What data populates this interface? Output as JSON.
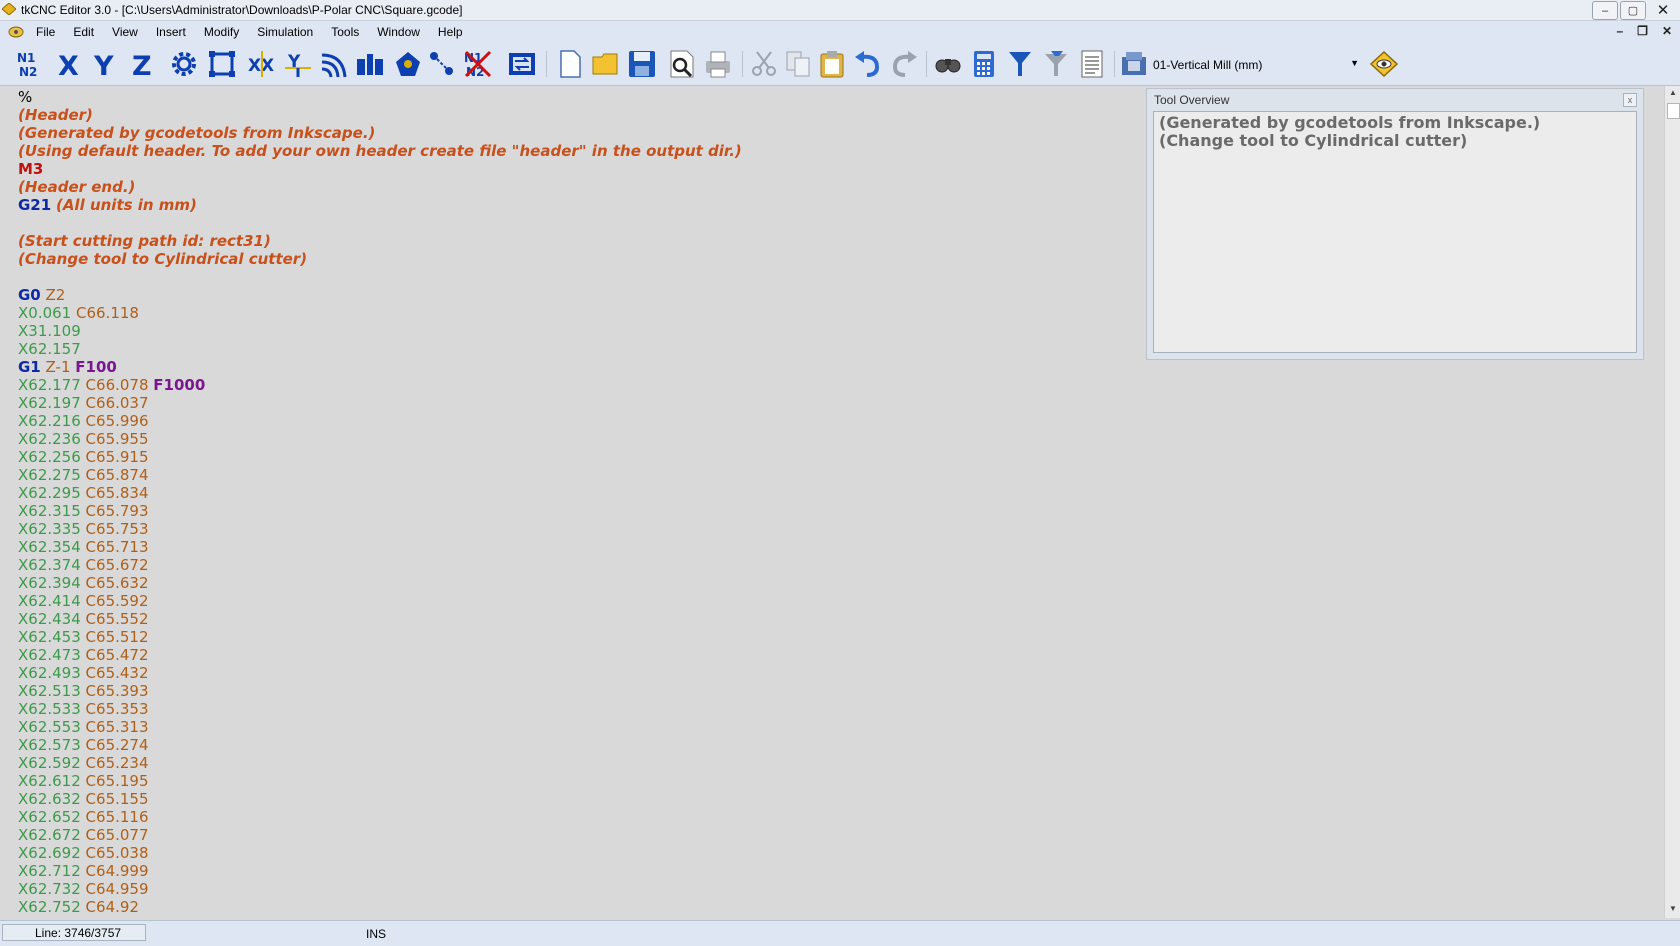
{
  "window": {
    "title": "tkCNC Editor 3.0 - [C:\\Users\\Administrator\\Downloads\\P-Polar CNC\\Square.gcode]",
    "controls": {
      "minimize": "–",
      "maximize": "▢",
      "close": "✕"
    }
  },
  "menu": {
    "items": [
      "File",
      "Edit",
      "View",
      "Insert",
      "Modify",
      "Simulation",
      "Tools",
      "Window",
      "Help"
    ],
    "mdi_controls": [
      "–",
      "❐",
      "✕"
    ]
  },
  "toolbar": {
    "machine_selector": "01-Vertical Mill (mm)",
    "buttons": [
      "renumber-icon",
      "axis-x-icon",
      "axis-y-icon",
      "axis-z-icon",
      "gear-icon",
      "bounding-box-icon",
      "swap-xy-icon",
      "mirror-icon",
      "arc-icon",
      "block-icon",
      "rotate-icon",
      "scale-icon",
      "remove-numbers-icon",
      "convert-icon",
      "new-file-icon",
      "open-folder-icon",
      "save-icon",
      "print-preview-icon",
      "print-icon",
      "cut-icon",
      "copy-icon",
      "paste-icon",
      "undo-icon",
      "redo-icon",
      "find-icon",
      "calculator-icon",
      "filter-icon",
      "filter-clear-icon",
      "document-properties-icon",
      "machine-icon",
      "simulate-icon"
    ]
  },
  "editor": {
    "lines": [
      [
        {
          "t": "%",
          "c": "pct"
        }
      ],
      [
        {
          "t": "(Header)",
          "c": "comment"
        }
      ],
      [
        {
          "t": "(Generated by gcodetools from Inkscape.)",
          "c": "comment"
        }
      ],
      [
        {
          "t": "(Using default header. To add your own header create file \"header\" in the output dir.)",
          "c": "comment"
        }
      ],
      [
        {
          "t": "M3",
          "c": "m"
        }
      ],
      [
        {
          "t": "(Header end.)",
          "c": "comment"
        }
      ],
      [
        {
          "t": "G21",
          "c": "g"
        },
        {
          "t": " "
        },
        {
          "t": "(All units in mm)",
          "c": "comment"
        }
      ],
      [],
      [
        {
          "t": "(Start cutting path id: rect31)",
          "c": "comment"
        }
      ],
      [
        {
          "t": "(Change tool to Cylindrical cutter)",
          "c": "comment"
        }
      ],
      [],
      [
        {
          "t": "G0",
          "c": "g"
        },
        {
          "t": " "
        },
        {
          "t": "Z2",
          "c": "z"
        }
      ],
      [
        {
          "t": "X0.061",
          "c": "x"
        },
        {
          "t": " "
        },
        {
          "t": "C66.118",
          "c": "c"
        }
      ],
      [
        {
          "t": "X31.109",
          "c": "x"
        }
      ],
      [
        {
          "t": "X62.157",
          "c": "x"
        }
      ],
      [
        {
          "t": "G1",
          "c": "g"
        },
        {
          "t": " "
        },
        {
          "t": "Z-1",
          "c": "z"
        },
        {
          "t": " "
        },
        {
          "t": "F100",
          "c": "f"
        }
      ],
      [
        {
          "t": "X62.177",
          "c": "x"
        },
        {
          "t": " "
        },
        {
          "t": "C66.078",
          "c": "c"
        },
        {
          "t": " "
        },
        {
          "t": "F1000",
          "c": "f"
        }
      ],
      [
        {
          "t": "X62.197",
          "c": "x"
        },
        {
          "t": " "
        },
        {
          "t": "C66.037",
          "c": "c"
        }
      ],
      [
        {
          "t": "X62.216",
          "c": "x"
        },
        {
          "t": " "
        },
        {
          "t": "C65.996",
          "c": "c"
        }
      ],
      [
        {
          "t": "X62.236",
          "c": "x"
        },
        {
          "t": " "
        },
        {
          "t": "C65.955",
          "c": "c"
        }
      ],
      [
        {
          "t": "X62.256",
          "c": "x"
        },
        {
          "t": " "
        },
        {
          "t": "C65.915",
          "c": "c"
        }
      ],
      [
        {
          "t": "X62.275",
          "c": "x"
        },
        {
          "t": " "
        },
        {
          "t": "C65.874",
          "c": "c"
        }
      ],
      [
        {
          "t": "X62.295",
          "c": "x"
        },
        {
          "t": " "
        },
        {
          "t": "C65.834",
          "c": "c"
        }
      ],
      [
        {
          "t": "X62.315",
          "c": "x"
        },
        {
          "t": " "
        },
        {
          "t": "C65.793",
          "c": "c"
        }
      ],
      [
        {
          "t": "X62.335",
          "c": "x"
        },
        {
          "t": " "
        },
        {
          "t": "C65.753",
          "c": "c"
        }
      ],
      [
        {
          "t": "X62.354",
          "c": "x"
        },
        {
          "t": " "
        },
        {
          "t": "C65.713",
          "c": "c"
        }
      ],
      [
        {
          "t": "X62.374",
          "c": "x"
        },
        {
          "t": " "
        },
        {
          "t": "C65.672",
          "c": "c"
        }
      ],
      [
        {
          "t": "X62.394",
          "c": "x"
        },
        {
          "t": " "
        },
        {
          "t": "C65.632",
          "c": "c"
        }
      ],
      [
        {
          "t": "X62.414",
          "c": "x"
        },
        {
          "t": " "
        },
        {
          "t": "C65.592",
          "c": "c"
        }
      ],
      [
        {
          "t": "X62.434",
          "c": "x"
        },
        {
          "t": " "
        },
        {
          "t": "C65.552",
          "c": "c"
        }
      ],
      [
        {
          "t": "X62.453",
          "c": "x"
        },
        {
          "t": " "
        },
        {
          "t": "C65.512",
          "c": "c"
        }
      ],
      [
        {
          "t": "X62.473",
          "c": "x"
        },
        {
          "t": " "
        },
        {
          "t": "C65.472",
          "c": "c"
        }
      ],
      [
        {
          "t": "X62.493",
          "c": "x"
        },
        {
          "t": " "
        },
        {
          "t": "C65.432",
          "c": "c"
        }
      ],
      [
        {
          "t": "X62.513",
          "c": "x"
        },
        {
          "t": " "
        },
        {
          "t": "C65.393",
          "c": "c"
        }
      ],
      [
        {
          "t": "X62.533",
          "c": "x"
        },
        {
          "t": " "
        },
        {
          "t": "C65.353",
          "c": "c"
        }
      ],
      [
        {
          "t": "X62.553",
          "c": "x"
        },
        {
          "t": " "
        },
        {
          "t": "C65.313",
          "c": "c"
        }
      ],
      [
        {
          "t": "X62.573",
          "c": "x"
        },
        {
          "t": " "
        },
        {
          "t": "C65.274",
          "c": "c"
        }
      ],
      [
        {
          "t": "X62.592",
          "c": "x"
        },
        {
          "t": " "
        },
        {
          "t": "C65.234",
          "c": "c"
        }
      ],
      [
        {
          "t": "X62.612",
          "c": "x"
        },
        {
          "t": " "
        },
        {
          "t": "C65.195",
          "c": "c"
        }
      ],
      [
        {
          "t": "X62.632",
          "c": "x"
        },
        {
          "t": " "
        },
        {
          "t": "C65.155",
          "c": "c"
        }
      ],
      [
        {
          "t": "X62.652",
          "c": "x"
        },
        {
          "t": " "
        },
        {
          "t": "C65.116",
          "c": "c"
        }
      ],
      [
        {
          "t": "X62.672",
          "c": "x"
        },
        {
          "t": " "
        },
        {
          "t": "C65.077",
          "c": "c"
        }
      ],
      [
        {
          "t": "X62.692",
          "c": "x"
        },
        {
          "t": " "
        },
        {
          "t": "C65.038",
          "c": "c"
        }
      ],
      [
        {
          "t": "X62.712",
          "c": "x"
        },
        {
          "t": " "
        },
        {
          "t": "C64.999",
          "c": "c"
        }
      ],
      [
        {
          "t": "X62.732",
          "c": "x"
        },
        {
          "t": " "
        },
        {
          "t": "C64.959",
          "c": "c"
        }
      ],
      [
        {
          "t": "X62.752",
          "c": "x"
        },
        {
          "t": " "
        },
        {
          "t": "C64.92",
          "c": "c"
        }
      ]
    ]
  },
  "tool_overview": {
    "title": "Tool Overview",
    "close": "x",
    "text": "(Generated by gcodetools from Inkscape.)\n(Change tool to Cylindrical cutter)"
  },
  "status": {
    "line": "Line: 3746/3757",
    "mode": "INS"
  },
  "colors": {
    "comment": "#c8501a",
    "m_code": "#c01010",
    "g_code": "#0c2aa8",
    "x_value": "#3c9a4a",
    "c_value": "#b05f18",
    "feed": "#7a1690",
    "toolbar_bg": "#dde6f2",
    "editor_bg": "#d9d9d9"
  }
}
